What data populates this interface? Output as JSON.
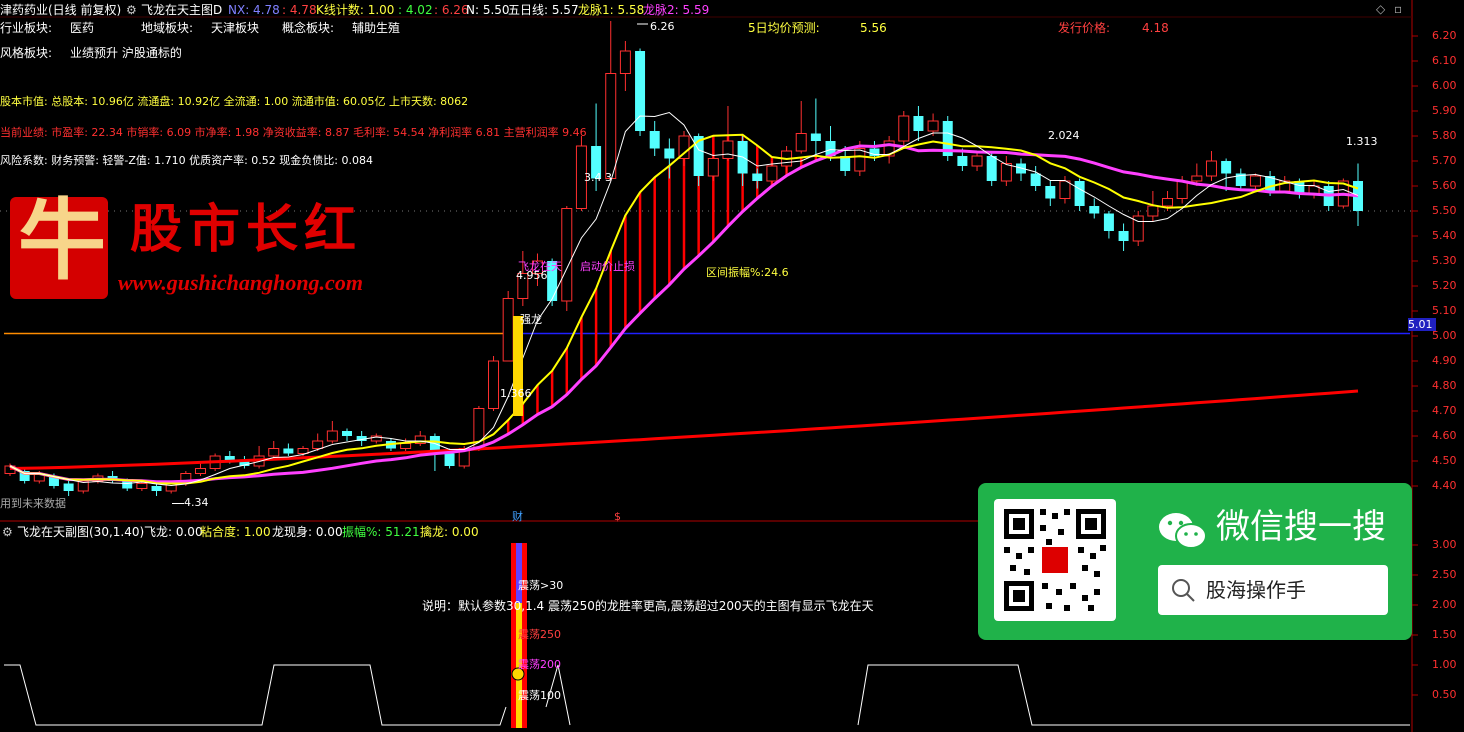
{
  "header": {
    "stock_name": "津药药业(日线 前复权)",
    "indicator_name": "飞龙在天主图D",
    "nx_label": "NX: 4.78",
    "nx_value": ": 4.78",
    "kcount_label": "K线计数: 1.00",
    "up_value": ": 4.02",
    "down_value": ": 6.26",
    "n_label": "N: 5.50",
    "ma5_label": "五日线: 5.57",
    "longmai1_label": "龙脉1: 5.58",
    "longmai2_label": "龙脉2: 5.59"
  },
  "info": {
    "industry_label": "行业板块:",
    "industry_value": "医药",
    "region_label": "地域板块:",
    "region_value": "天津板块",
    "concept_label": "概念板块:",
    "concept_value": "辅助生殖",
    "forecast_label": "5日均价预测:",
    "forecast_value": "5.56",
    "issue_label": "发行价格:",
    "issue_value": "4.18",
    "style_label": "风格板块:",
    "style_value": "业绩预升 沪股通标的",
    "capital_line": "股本市值: 总股本: 10.96亿 流通盘: 10.92亿 全流通: 1.00 流通市值: 60.05亿 上市天数: 8062",
    "performance_line": "当前业绩: 市盈率: 22.34 市销率: 6.09 市净率: 1.98 净资收益率: 8.87 毛利率: 54.54 净利润率 6.81 主营利润率 9.46",
    "risk_line": "风险系数: 财务预警: 轻警-Z值: 1.710 优质资产率: 0.52 现金负债比: 0.084"
  },
  "watermark": {
    "bull_char": "牛",
    "title": "股市长红",
    "url": "www.gushichanghong.com"
  },
  "annotations": {
    "high_label": "6.26",
    "low_label": "4.34",
    "label_3_4": "3.4 3",
    "label_4_956": "4.956",
    "label_1_366": "1.366",
    "label_strong": "强龙",
    "label_feilong": "飞龙在天",
    "label_stop": "启动价止损",
    "label_amp": "区间振幅%:24.6",
    "label_2024": "2.024",
    "label_1313": "1.313",
    "label_future": "用到未来数据",
    "price_tag": "5.01",
    "marker_cai": "财",
    "marker_s": "$"
  },
  "axis_main": [
    "6.20",
    "6.10",
    "6.00",
    "5.90",
    "5.80",
    "5.70",
    "5.60",
    "5.50",
    "5.40",
    "5.30",
    "5.20",
    "5.10",
    "5.00",
    "4.90",
    "4.80",
    "4.70",
    "4.60",
    "4.50",
    "4.40"
  ],
  "axis_sub": [
    "3.00",
    "2.50",
    "2.00",
    "1.50",
    "1.00",
    "0.50"
  ],
  "sub": {
    "title": "飞龙在天副图(30,1.40)",
    "feilong": "飞龙: 0.00",
    "nianhe": "粘合度: 1.00",
    "longxian": "龙现身: 0.00",
    "zhenfu": "振幅%: 51.21",
    "qinlong": "擒龙: 0.00",
    "note": "说明：默认参数30,1.4 震荡250的龙胜率更高,震荡超过200天的主图有显示飞龙在天",
    "z30": "震荡>30",
    "z250": "震荡250",
    "z200": "震荡200",
    "z100": "震荡100"
  },
  "wechat": {
    "title": "微信搜一搜",
    "search_text": "股海操作手"
  },
  "colors": {
    "up": "#ff3030",
    "down": "#54ffff",
    "ma_yellow": "#ffff00",
    "ma_magenta": "#ff40ff",
    "ma_red": "#ff0000",
    "axis": "#b00000"
  },
  "chart_data": {
    "type": "candlestick",
    "ylim": [
      4.3,
      6.28
    ],
    "sub_ylim": [
      0,
      3.2
    ],
    "candles": [
      [
        4.45,
        4.48,
        4.49,
        4.44
      ],
      [
        4.46,
        4.42,
        4.47,
        4.41
      ],
      [
        4.42,
        4.45,
        4.46,
        4.41
      ],
      [
        4.44,
        4.4,
        4.45,
        4.39
      ],
      [
        4.41,
        4.38,
        4.42,
        4.36
      ],
      [
        4.38,
        4.42,
        4.43,
        4.37
      ],
      [
        4.42,
        4.44,
        4.45,
        4.41
      ],
      [
        4.44,
        4.42,
        4.46,
        4.41
      ],
      [
        4.42,
        4.39,
        4.43,
        4.38
      ],
      [
        4.39,
        4.41,
        4.42,
        4.38
      ],
      [
        4.4,
        4.38,
        4.41,
        4.36
      ],
      [
        4.38,
        4.41,
        4.42,
        4.37
      ],
      [
        4.41,
        4.45,
        4.46,
        4.4
      ],
      [
        4.45,
        4.47,
        4.5,
        4.44
      ],
      [
        4.47,
        4.52,
        4.53,
        4.46
      ],
      [
        4.52,
        4.5,
        4.54,
        4.49
      ],
      [
        4.5,
        4.48,
        4.52,
        4.47
      ],
      [
        4.48,
        4.52,
        4.56,
        4.47
      ],
      [
        4.52,
        4.55,
        4.58,
        4.51
      ],
      [
        4.55,
        4.53,
        4.57,
        4.52
      ],
      [
        4.53,
        4.55,
        4.56,
        4.52
      ],
      [
        4.55,
        4.58,
        4.61,
        4.54
      ],
      [
        4.58,
        4.62,
        4.66,
        4.57
      ],
      [
        4.62,
        4.6,
        4.63,
        4.58
      ],
      [
        4.6,
        4.58,
        4.62,
        4.56
      ],
      [
        4.58,
        4.6,
        4.61,
        4.57
      ],
      [
        4.58,
        4.55,
        4.59,
        4.54
      ],
      [
        4.55,
        4.57,
        4.59,
        4.54
      ],
      [
        4.57,
        4.6,
        4.62,
        4.56
      ],
      [
        4.6,
        4.53,
        4.61,
        4.46
      ],
      [
        4.53,
        4.48,
        4.55,
        4.47
      ],
      [
        4.48,
        4.55,
        4.56,
        4.47
      ],
      [
        4.55,
        4.71,
        4.72,
        4.54
      ],
      [
        4.71,
        4.9,
        4.92,
        4.7
      ],
      [
        4.9,
        5.15,
        5.18,
        4.9
      ],
      [
        5.15,
        5.25,
        5.34,
        5.12
      ],
      [
        5.25,
        5.3,
        5.33,
        5.2
      ],
      [
        5.3,
        5.14,
        5.31,
        5.12
      ],
      [
        5.14,
        5.51,
        5.52,
        5.1
      ],
      [
        5.51,
        5.76,
        5.8,
        5.5
      ],
      [
        5.76,
        5.63,
        5.93,
        5.58
      ],
      [
        5.63,
        6.05,
        6.26,
        5.62
      ],
      [
        6.05,
        6.14,
        6.18,
        5.98
      ],
      [
        6.14,
        5.82,
        6.15,
        5.8
      ],
      [
        5.82,
        5.75,
        5.86,
        5.72
      ],
      [
        5.75,
        5.71,
        5.79,
        5.63
      ],
      [
        5.71,
        5.8,
        5.82,
        5.68
      ],
      [
        5.8,
        5.64,
        5.81,
        5.6
      ],
      [
        5.64,
        5.71,
        5.73,
        5.62
      ],
      [
        5.71,
        5.78,
        5.92,
        5.7
      ],
      [
        5.78,
        5.65,
        5.8,
        5.6
      ],
      [
        5.65,
        5.62,
        5.67,
        5.59
      ],
      [
        5.62,
        5.68,
        5.7,
        5.6
      ],
      [
        5.68,
        5.74,
        5.76,
        5.65
      ],
      [
        5.74,
        5.81,
        5.94,
        5.73
      ],
      [
        5.81,
        5.78,
        5.95,
        5.72
      ],
      [
        5.78,
        5.72,
        5.84,
        5.7
      ],
      [
        5.72,
        5.66,
        5.76,
        5.64
      ],
      [
        5.66,
        5.75,
        5.78,
        5.64
      ],
      [
        5.75,
        5.72,
        5.78,
        5.7
      ],
      [
        5.72,
        5.78,
        5.8,
        5.69
      ],
      [
        5.78,
        5.88,
        5.9,
        5.76
      ],
      [
        5.88,
        5.82,
        5.92,
        5.78
      ],
      [
        5.82,
        5.86,
        5.89,
        5.8
      ],
      [
        5.86,
        5.72,
        5.88,
        5.7
      ],
      [
        5.72,
        5.68,
        5.75,
        5.66
      ],
      [
        5.68,
        5.72,
        5.74,
        5.66
      ],
      [
        5.72,
        5.62,
        5.74,
        5.6
      ],
      [
        5.62,
        5.69,
        5.72,
        5.6
      ],
      [
        5.69,
        5.65,
        5.71,
        5.62
      ],
      [
        5.65,
        5.6,
        5.68,
        5.58
      ],
      [
        5.6,
        5.55,
        5.62,
        5.52
      ],
      [
        5.55,
        5.62,
        5.64,
        5.53
      ],
      [
        5.62,
        5.52,
        5.63,
        5.5
      ],
      [
        5.52,
        5.49,
        5.55,
        5.47
      ],
      [
        5.49,
        5.42,
        5.5,
        5.39
      ],
      [
        5.42,
        5.38,
        5.45,
        5.34
      ],
      [
        5.38,
        5.48,
        5.5,
        5.36
      ],
      [
        5.48,
        5.52,
        5.58,
        5.46
      ],
      [
        5.52,
        5.55,
        5.58,
        5.5
      ],
      [
        5.55,
        5.62,
        5.64,
        5.53
      ],
      [
        5.62,
        5.64,
        5.69,
        5.6
      ],
      [
        5.64,
        5.7,
        5.74,
        5.62
      ],
      [
        5.7,
        5.65,
        5.71,
        5.58
      ],
      [
        5.65,
        5.6,
        5.67,
        5.58
      ],
      [
        5.6,
        5.64,
        5.65,
        5.58
      ],
      [
        5.64,
        5.58,
        5.66,
        5.56
      ],
      [
        5.58,
        5.62,
        5.64,
        5.57
      ],
      [
        5.62,
        5.57,
        5.63,
        5.55
      ],
      [
        5.57,
        5.6,
        5.62,
        5.55
      ],
      [
        5.6,
        5.52,
        5.62,
        5.5
      ],
      [
        5.52,
        5.62,
        5.63,
        5.51
      ],
      [
        5.62,
        5.5,
        5.69,
        5.44
      ]
    ]
  }
}
